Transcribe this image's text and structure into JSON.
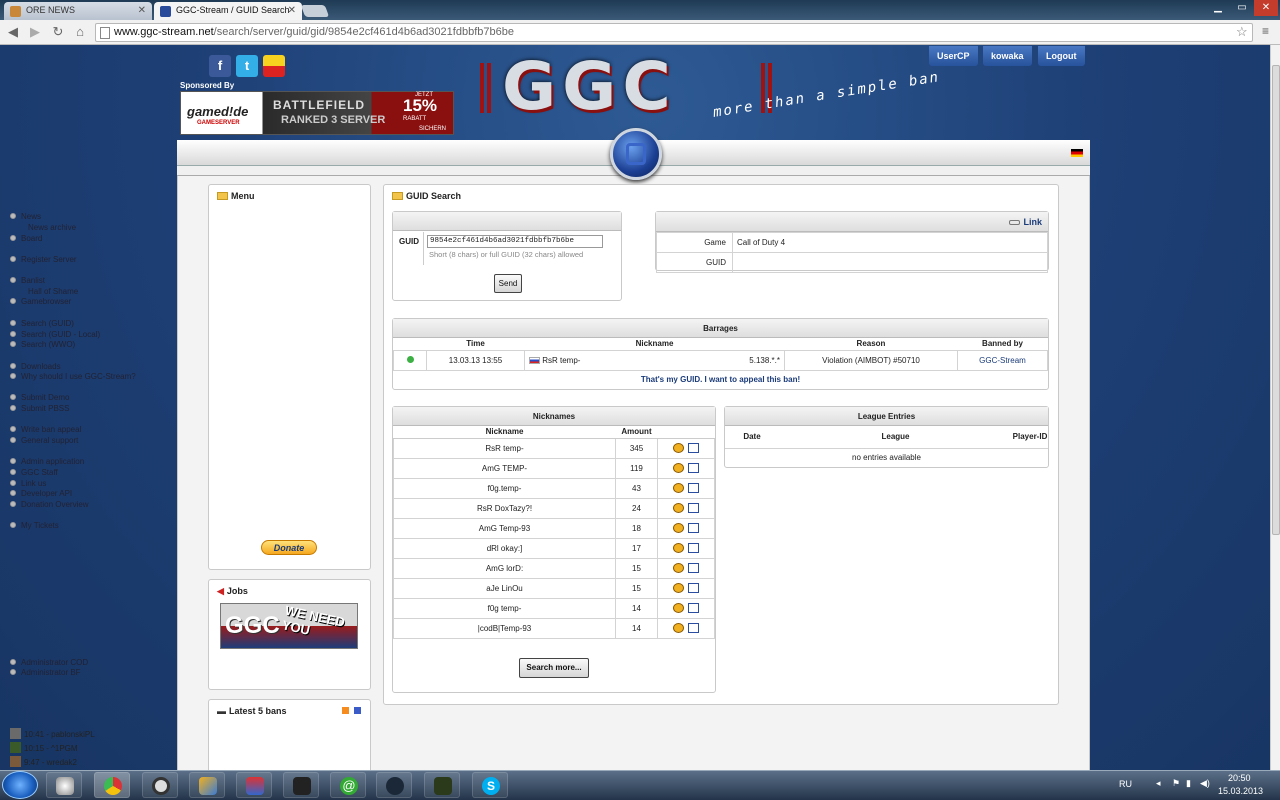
{
  "browser": {
    "tabs": [
      {
        "title": "ORE NEWS",
        "active": false
      },
      {
        "title": "GGC-Stream / GUID Search",
        "active": true
      }
    ],
    "url_domain": "www.ggc-stream.net",
    "url_path": "/search/server/guid/gid/9854e2cf461d4b6ad3021fdbbfb7b6be"
  },
  "header": {
    "sponsored_label": "Sponsored By",
    "banner": {
      "brand": "gamed!de",
      "sub": "GAMESERVER",
      "line1": "BATTLEFIELD",
      "line2": "RANKED 3 SERVER",
      "percent": "15%",
      "jetzt": "JETZT",
      "rabatt": "RABATT",
      "sichern": "SICHERN"
    },
    "logo_text": "GGC",
    "tagline": "more than a simple ban",
    "user_buttons": [
      "UserCP",
      "kowaka",
      "Logout"
    ]
  },
  "menu": {
    "title": "Menu",
    "items": [
      {
        "label": "News",
        "sub": false
      },
      {
        "label": "News archive",
        "sub": true
      },
      {
        "label": "Board",
        "sub": false
      },
      {
        "label": "Register Server",
        "sub": false
      },
      {
        "label": "Banlist",
        "sub": false
      },
      {
        "label": "Hall of Shame",
        "sub": true
      },
      {
        "label": "Gamebrowser",
        "sub": false
      },
      {
        "label": "Search (GUID)",
        "sub": false
      },
      {
        "label": "Search (GUID - Local)",
        "sub": false
      },
      {
        "label": "Search (WWO)",
        "sub": false
      },
      {
        "label": "Downloads",
        "sub": false
      },
      {
        "label": "Why should I use GGC-Stream?",
        "sub": false
      },
      {
        "label": "Submit Demo",
        "sub": false
      },
      {
        "label": "Submit PBSS",
        "sub": false
      },
      {
        "label": "Write ban appeal",
        "sub": false
      },
      {
        "label": "General support",
        "sub": false
      },
      {
        "label": "Admin application",
        "sub": false
      },
      {
        "label": "GGC Staff",
        "sub": false
      },
      {
        "label": "Link us",
        "sub": false
      },
      {
        "label": "Developer API",
        "sub": false
      },
      {
        "label": "Donation Overview",
        "sub": false
      },
      {
        "label": "My Tickets",
        "sub": false
      }
    ],
    "donate_label": "Donate"
  },
  "jobs": {
    "title": "Jobs",
    "image_text": "GGC",
    "image_overlay": "WE NEED YOU",
    "items": [
      "Administrator COD",
      "Administrator BF"
    ]
  },
  "latest": {
    "title": "Latest 5 bans",
    "items": [
      "10:41 - pablonskiPL",
      "10:15 - ^1PGM",
      "9:47 - wredak2"
    ]
  },
  "guid_search": {
    "title": "GUID Search",
    "guid_label": "GUID",
    "guid_value": "9854e2cf461d4b6ad3021fdbbfb7b6be",
    "hint": "Short (8 chars) or full GUID (32 chars) allowed",
    "send_label": "Send"
  },
  "game_info": {
    "link_label": "Link",
    "rows": [
      {
        "label": "Game",
        "value": "Call of Duty 4"
      },
      {
        "label": "GUID",
        "value": ""
      }
    ]
  },
  "barrages": {
    "title": "Barrages",
    "columns": [
      "Time",
      "Nickname",
      "Reason",
      "Banned by"
    ],
    "row": {
      "time": "13.03.13 13:55",
      "nickname": "RsR temp-",
      "ip": "5.138.*.*",
      "reason": "Violation (AIMBOT) #50710",
      "banned_by": "GGC-Stream",
      "status_color": "#3cb043"
    },
    "appeal_link": "That's my GUID. I want to appeal this ban!"
  },
  "nicknames": {
    "title": "Nicknames",
    "columns": [
      "Nickname",
      "Amount"
    ],
    "rows": [
      {
        "nickname": "RsR temp-",
        "amount": "345"
      },
      {
        "nickname": "AmG TEMP-",
        "amount": "119"
      },
      {
        "nickname": "f0g.temp-",
        "amount": "43"
      },
      {
        "nickname": "RsR DoxTazy?!",
        "amount": "24"
      },
      {
        "nickname": "AmG Temp-93",
        "amount": "18"
      },
      {
        "nickname": "dRl okay:]",
        "amount": "17"
      },
      {
        "nickname": "AmG lorD:",
        "amount": "15"
      },
      {
        "nickname": "aJe LinOu",
        "amount": "15"
      },
      {
        "nickname": "f0g temp-",
        "amount": "14"
      },
      {
        "nickname": "|codB|Temp-93",
        "amount": "14"
      }
    ],
    "search_more_label": "Search more..."
  },
  "league": {
    "title": "League Entries",
    "columns": [
      "Date",
      "League",
      "Player-ID"
    ],
    "empty": "no entries available"
  },
  "taskbar": {
    "lang": "RU",
    "time": "20:50",
    "date": "15.03.2013"
  }
}
